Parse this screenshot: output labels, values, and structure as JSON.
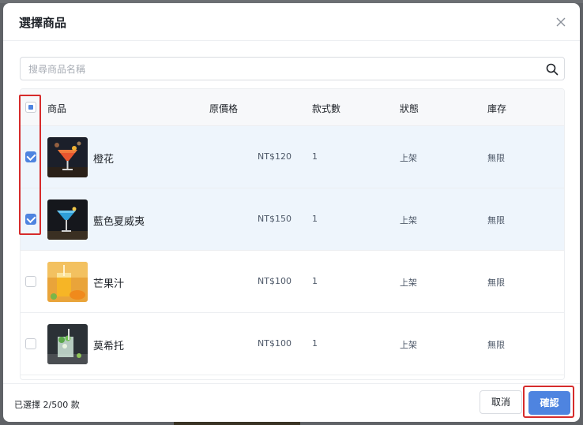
{
  "modal": {
    "title": "選擇商品"
  },
  "search": {
    "placeholder": "搜尋商品名稱"
  },
  "table": {
    "columns": [
      "商品",
      "原價格",
      "款式數",
      "狀態",
      "庫存"
    ],
    "rows": [
      {
        "name": "橙花",
        "price": "NT$120",
        "variants": "1",
        "status": "上架",
        "stock": "無限",
        "selected": true
      },
      {
        "name": "藍色夏威夷",
        "price": "NT$150",
        "variants": "1",
        "status": "上架",
        "stock": "無限",
        "selected": true
      },
      {
        "name": "芒果汁",
        "price": "NT$100",
        "variants": "1",
        "status": "上架",
        "stock": "無限",
        "selected": false
      },
      {
        "name": "莫希托",
        "price": "NT$100",
        "variants": "1",
        "status": "上架",
        "stock": "無限",
        "selected": false
      }
    ]
  },
  "footer": {
    "selected_count": "已選擇 2/500 款",
    "cancel_label": "取消",
    "confirm_label": "確認"
  },
  "colors": {
    "accent": "#4e84e0",
    "selected_row": "#eef5fc",
    "annotation": "#d62b2b"
  },
  "icons": {
    "close": "close-icon",
    "search": "search-icon"
  }
}
